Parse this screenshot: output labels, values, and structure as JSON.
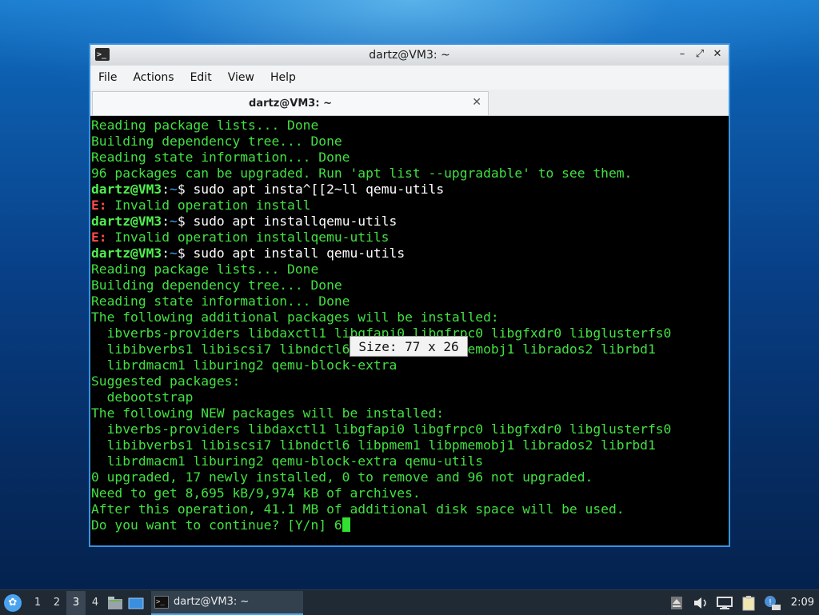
{
  "window": {
    "title": "dartz@VM3: ~",
    "controls": [
      "–",
      "⤢",
      "✕"
    ],
    "menu": [
      "File",
      "Actions",
      "Edit",
      "View",
      "Help"
    ],
    "tab_label": "dartz@VM3: ~",
    "tab_close": "✕"
  },
  "terminal": {
    "lines": [
      {
        "type": "out",
        "text": "Reading package lists... Done"
      },
      {
        "type": "out",
        "text": "Building dependency tree... Done"
      },
      {
        "type": "out",
        "text": "Reading state information... Done"
      },
      {
        "type": "out",
        "text": "96 packages can be upgraded. Run 'apt list --upgradable' to see them."
      },
      {
        "type": "prompt",
        "user": "dartz@VM3",
        "path": "~",
        "cmd": "$ sudo apt insta^[[2~ll qemu-utils"
      },
      {
        "type": "err",
        "text": " Invalid operation install"
      },
      {
        "type": "prompt",
        "user": "dartz@VM3",
        "path": "~",
        "cmd": "$ sudo apt installqemu-utils"
      },
      {
        "type": "err",
        "text": " Invalid operation installqemu-utils"
      },
      {
        "type": "prompt",
        "user": "dartz@VM3",
        "path": "~",
        "cmd": "$ sudo apt install qemu-utils"
      },
      {
        "type": "out",
        "text": "Reading package lists... Done"
      },
      {
        "type": "out",
        "text": "Building dependency tree... Done"
      },
      {
        "type": "out",
        "text": "Reading state information... Done"
      },
      {
        "type": "out",
        "text": "The following additional packages will be installed:"
      },
      {
        "type": "out",
        "text": "  ibverbs-providers libdaxctl1 libgfapi0 libgfrpc0 libgfxdr0 libglusterfs0"
      },
      {
        "type": "out",
        "text": "  libibverbs1 libiscsi7 libndctl6 libpmem1 libpmemobj1 librados2 librbd1"
      },
      {
        "type": "out",
        "text": "  librdmacm1 liburing2 qemu-block-extra"
      },
      {
        "type": "out",
        "text": "Suggested packages:"
      },
      {
        "type": "out",
        "text": "  debootstrap"
      },
      {
        "type": "out",
        "text": "The following NEW packages will be installed:"
      },
      {
        "type": "out",
        "text": "  ibverbs-providers libdaxctl1 libgfapi0 libgfrpc0 libgfxdr0 libglusterfs0"
      },
      {
        "type": "out",
        "text": "  libibverbs1 libiscsi7 libndctl6 libpmem1 libpmemobj1 librados2 librbd1"
      },
      {
        "type": "out",
        "text": "  librdmacm1 liburing2 qemu-block-extra qemu-utils"
      },
      {
        "type": "out",
        "text": "0 upgraded, 17 newly installed, 0 to remove and 96 not upgraded."
      },
      {
        "type": "out",
        "text": "Need to get 8,695 kB/9,974 kB of archives."
      },
      {
        "type": "out",
        "text": "After this operation, 41.1 MB of additional disk space will be used."
      },
      {
        "type": "input",
        "text": "Do you want to continue? [Y/n] 6"
      }
    ],
    "error_prefix": "E:",
    "prompt_sep": ":",
    "size_tooltip": "Size: 77 x 26"
  },
  "taskbar": {
    "workspaces": [
      "1",
      "2",
      "3",
      "4"
    ],
    "active_workspace": "3",
    "task_label": "dartz@VM3: ~",
    "clock": "2:09"
  }
}
